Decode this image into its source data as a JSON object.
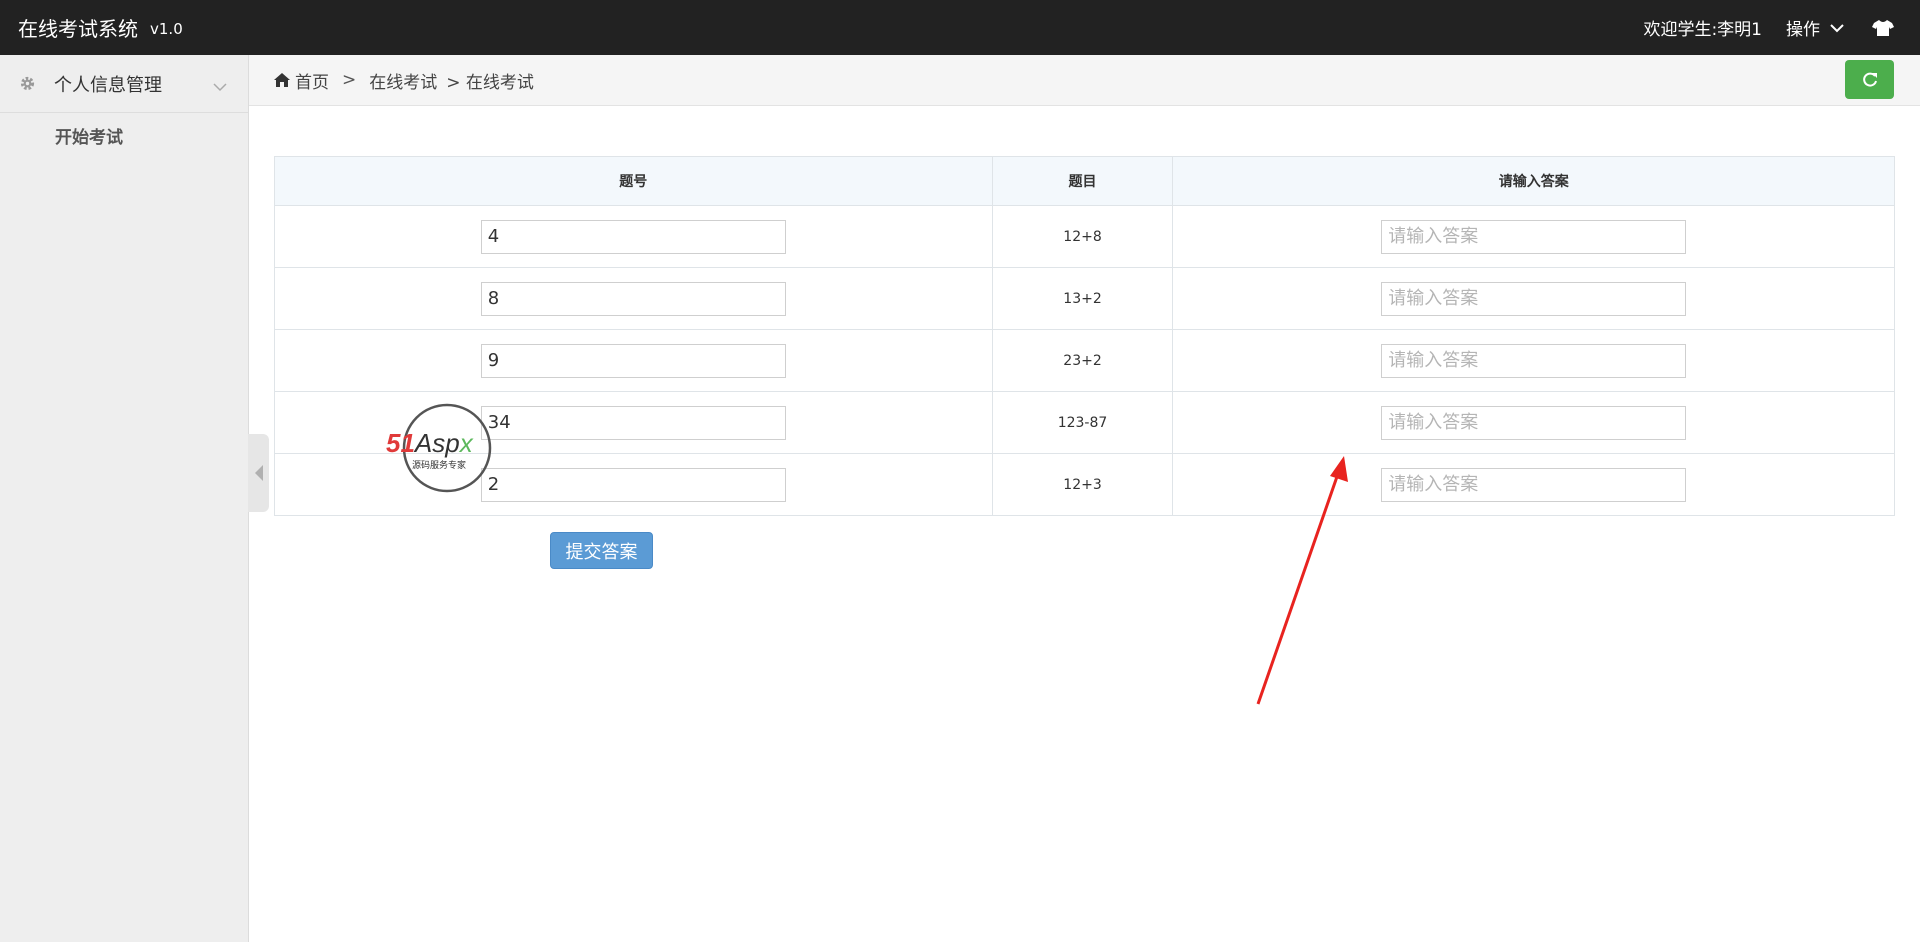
{
  "app": {
    "title": "在线考试系统",
    "version": "v1.0"
  },
  "topbar": {
    "welcome": "欢迎学生:李明1",
    "operation": "操作"
  },
  "sidebar": {
    "group_label": "个人信息管理",
    "items": [
      {
        "label": "开始考试"
      }
    ]
  },
  "breadcrumb": {
    "home": "首页",
    "sep": ">",
    "level1": "在线考试",
    "level2": "> 在线考试"
  },
  "table": {
    "headers": [
      "题号",
      "题目",
      "请输入答案"
    ],
    "rows": [
      {
        "number": "4",
        "question": "12+8",
        "answer": "",
        "placeholder": "请输入答案"
      },
      {
        "number": "8",
        "question": "13+2",
        "answer": "",
        "placeholder": "请输入答案"
      },
      {
        "number": "9",
        "question": "23+2",
        "answer": "",
        "placeholder": "请输入答案"
      },
      {
        "number": "34",
        "question": "123-87",
        "answer": "",
        "placeholder": "请输入答案"
      },
      {
        "number": "2",
        "question": "12+3",
        "answer": "",
        "placeholder": "请输入答案"
      }
    ]
  },
  "submit_label": "提交答案",
  "watermark": {
    "brand": "51Aspx",
    "tagline": "源码服务专家"
  },
  "colors": {
    "topbar": "#222222",
    "submit": "#5b9bd5",
    "refresh": "#4cae4c",
    "arrow": "#e8231f"
  },
  "icons": [
    "gear-icon",
    "chevron-down-icon",
    "tshirt-icon",
    "home-icon",
    "refresh-icon",
    "caret-left-icon"
  ]
}
